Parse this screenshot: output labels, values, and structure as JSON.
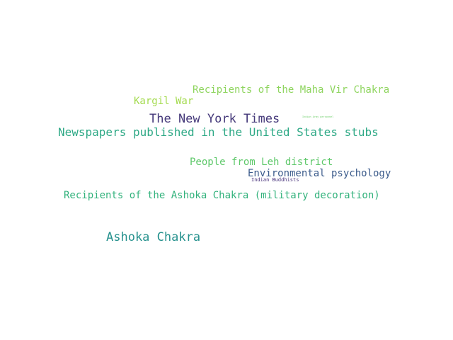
{
  "words": [
    {
      "text": "Recipients of the Maha Vir Chakra",
      "color": "#8fd55f"
    },
    {
      "text": "Kargil War",
      "color": "#a4db4f"
    },
    {
      "text": "The New York Times",
      "color": "#45397a"
    },
    {
      "text": "Indian Army personnel",
      "color": "#6ecf6a"
    },
    {
      "text": "Newspapers published in the United States stubs",
      "color": "#2ea986"
    },
    {
      "text": "People from Leh district",
      "color": "#5ec86a"
    },
    {
      "text": "Environmental psychology",
      "color": "#3b5b8b"
    },
    {
      "text": "Indian Buddhists",
      "color": "#46307a"
    },
    {
      "text": "Recipients of the Ashoka Chakra (military decoration)",
      "color": "#32b27c"
    },
    {
      "text": "Ashoka Chakra",
      "color": "#25918d"
    }
  ]
}
